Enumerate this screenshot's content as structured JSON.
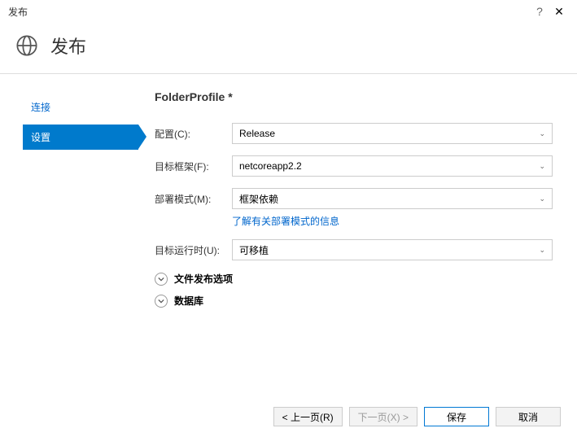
{
  "titlebar": {
    "title": "发布",
    "help": "?",
    "close": "✕"
  },
  "header": {
    "title": "发布"
  },
  "sidebar": {
    "items": [
      {
        "label": "连接",
        "active": false
      },
      {
        "label": "设置",
        "active": true
      }
    ]
  },
  "content": {
    "profile_name": "FolderProfile *",
    "fields": {
      "config": {
        "label": "配置(C):",
        "value": "Release"
      },
      "framework": {
        "label": "目标框架(F):",
        "value": "netcoreapp2.2"
      },
      "deploy_mode": {
        "label": "部署模式(M):",
        "value": "框架依赖",
        "link": "了解有关部署模式的信息"
      },
      "runtime": {
        "label": "目标运行时(U):",
        "value": "可移植"
      }
    },
    "expanders": {
      "file_publish": "文件发布选项",
      "database": "数据库"
    }
  },
  "footer": {
    "prev": "< 上一页(R)",
    "next": "下一页(X) >",
    "save": "保存",
    "cancel": "取消"
  }
}
